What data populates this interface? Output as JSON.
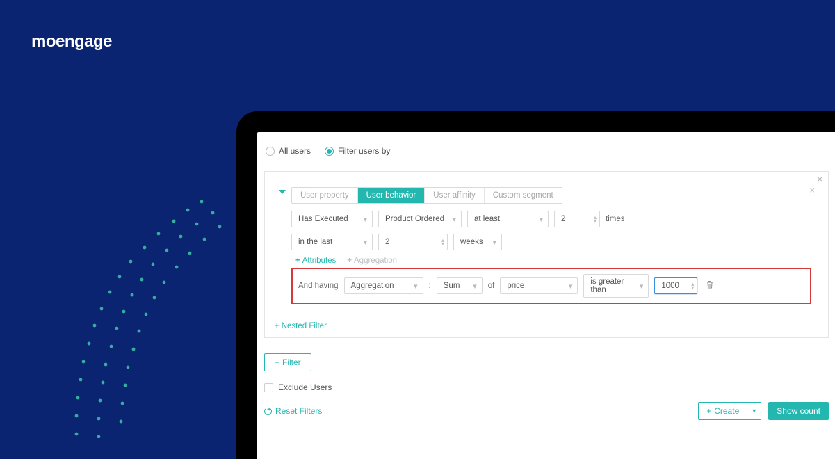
{
  "brand": "moengage",
  "radios": {
    "all_users": "All users",
    "filter_users": "Filter users by"
  },
  "tabs": {
    "user_property": "User property",
    "user_behavior": "User behavior",
    "user_affinity": "User affinity",
    "custom_segment": "Custom segment"
  },
  "row1": {
    "executed": "Has Executed",
    "event": "Product Ordered",
    "comparator": "at least",
    "count": "2",
    "times": "times"
  },
  "row2": {
    "range": "in the last",
    "value": "2",
    "unit": "weeks"
  },
  "addlinks": {
    "attributes": "Attributes",
    "aggregation": "Aggregation"
  },
  "agg": {
    "and_having": "And having",
    "type": "Aggregation",
    "colon": ":",
    "func": "Sum",
    "of": "of",
    "attr": "price",
    "op": "is greater than",
    "value": "1000"
  },
  "nested_filter": "Nested Filter",
  "filter_btn": "Filter",
  "exclude_users": "Exclude Users",
  "reset_filters": "Reset Filters",
  "create": "Create",
  "show_count": "Show count"
}
